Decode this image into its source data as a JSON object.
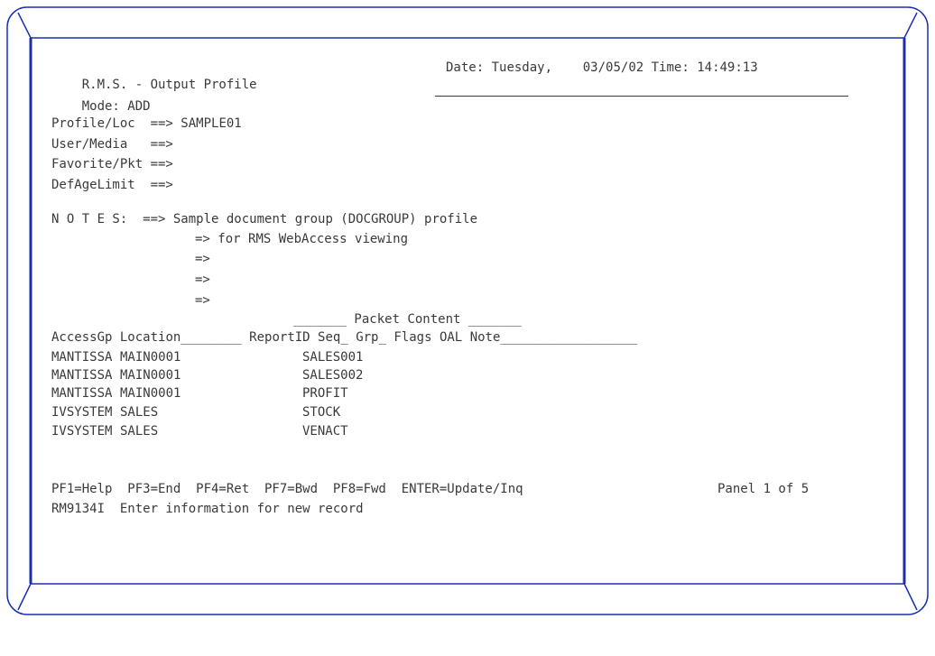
{
  "header": {
    "title": "R.M.S. - Output Profile",
    "date_label": "Date:",
    "day": "Tuesday,",
    "date": "03/05/02",
    "time_label": "Time:",
    "time": "14:49:13",
    "mode": "Mode: ADD",
    "message_field": ""
  },
  "fields": {
    "profile_loc": {
      "label": "Profile/Loc  ==>",
      "value": "SAMPLE01"
    },
    "user_media": {
      "label": "User/Media   ==>",
      "value": ""
    },
    "favorite_pkt": {
      "label": "Favorite/Pkt ==>",
      "value": ""
    },
    "def_age_limit": {
      "label": "DefAgeLimit  ==>",
      "value": ""
    }
  },
  "notes": {
    "label": "N O T E S:  ==>",
    "cont": "=>",
    "lines": [
      "Sample document group (DOCGROUP) profile",
      "for RMS WebAccess viewing",
      "",
      "",
      ""
    ]
  },
  "table": {
    "group_header": "_______ Packet Content _______",
    "columns": {
      "access": "AccessGp",
      "location": "Location________",
      "report": "ReportID",
      "seq": "Seq_",
      "grp": "Grp_",
      "flags": "Flags",
      "oal": "OAL",
      "note": "Note__________________"
    },
    "rows": [
      {
        "access": "MANTISSA",
        "location": "MAIN0001",
        "report": "SALES001"
      },
      {
        "access": "MANTISSA",
        "location": "MAIN0001",
        "report": "SALES002"
      },
      {
        "access": "MANTISSA",
        "location": "MAIN0001",
        "report": "PROFIT"
      },
      {
        "access": "IVSYSTEM",
        "location": "SALES",
        "report": "STOCK"
      },
      {
        "access": "IVSYSTEM",
        "location": "SALES",
        "report": "VENACT"
      }
    ]
  },
  "footer": {
    "pf_keys": "PF1=Help  PF3=End  PF4=Ret  PF7=Bwd  PF8=Fwd  ENTER=Update/Inq",
    "panel": "Panel 1 of 5",
    "message": "RM9134I  Enter information for new record"
  },
  "colors": {
    "frame": "#1a2fb0",
    "text": "#3a3a3a"
  }
}
